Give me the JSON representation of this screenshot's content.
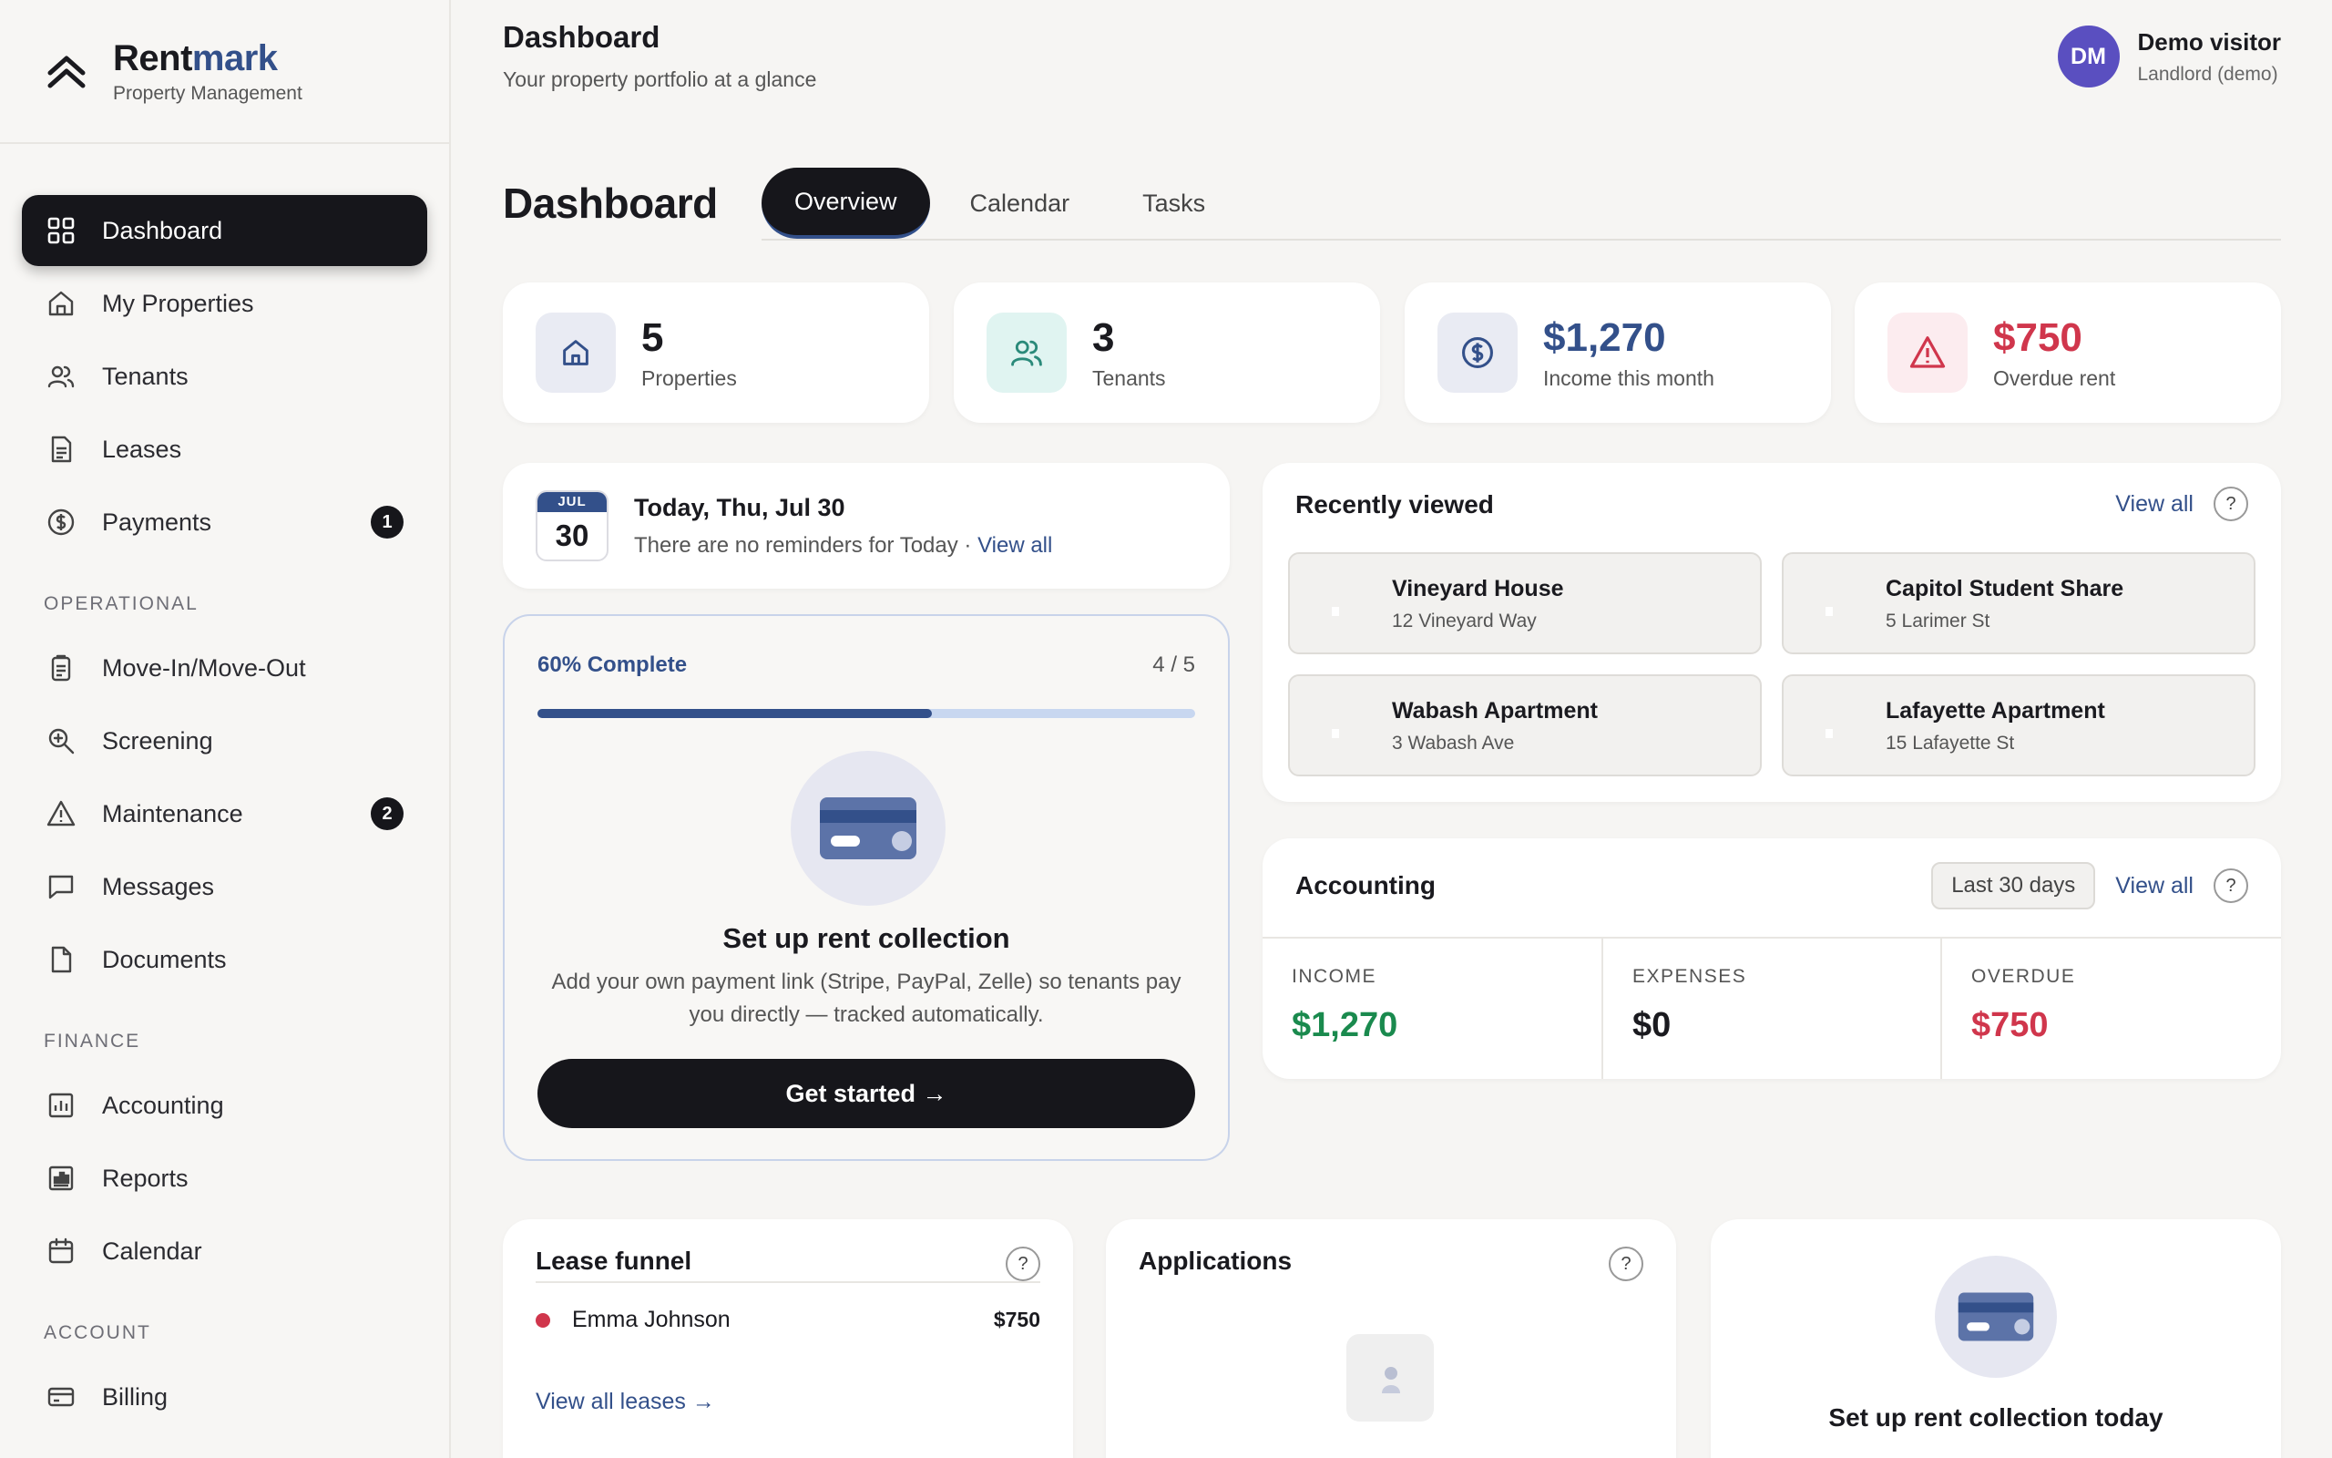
{
  "brand": {
    "name_a": "Rent",
    "name_b": "mark",
    "subtitle": "Property Management"
  },
  "nav": {
    "main": [
      {
        "label": "Dashboard",
        "icon": "grid-icon",
        "active": true
      },
      {
        "label": "My Properties",
        "icon": "home-icon"
      },
      {
        "label": "Tenants",
        "icon": "users-icon"
      },
      {
        "label": "Leases",
        "icon": "file-icon"
      },
      {
        "label": "Payments",
        "icon": "dollar-circle-icon",
        "badge": "1"
      }
    ],
    "operational_label": "OPERATIONAL",
    "operational": [
      {
        "label": "Move-In/Move-Out",
        "icon": "clipboard-icon"
      },
      {
        "label": "Screening",
        "icon": "zoom-in-icon"
      },
      {
        "label": "Maintenance",
        "icon": "warning-icon",
        "badge": "2"
      },
      {
        "label": "Messages",
        "icon": "message-icon"
      },
      {
        "label": "Documents",
        "icon": "document-icon"
      }
    ],
    "finance_label": "FINANCE",
    "finance": [
      {
        "label": "Accounting",
        "icon": "chart-icon"
      },
      {
        "label": "Reports",
        "icon": "report-icon"
      },
      {
        "label": "Calendar",
        "icon": "calendar-icon"
      }
    ],
    "account_label": "ACCOUNT",
    "account": [
      {
        "label": "Billing",
        "icon": "card-icon"
      }
    ]
  },
  "header": {
    "title": "Dashboard",
    "subtitle": "Your property portfolio at a glance"
  },
  "user": {
    "initials": "DM",
    "name": "Demo visitor",
    "role": "Landlord (demo)"
  },
  "page": {
    "title": "Dashboard",
    "tabs": [
      "Overview",
      "Calendar",
      "Tasks"
    ]
  },
  "stats": [
    {
      "value": "5",
      "label": "Properties",
      "color": "#1a1a1f"
    },
    {
      "value": "3",
      "label": "Tenants",
      "color": "#1a1a1f"
    },
    {
      "value": "$1,270",
      "label": "Income this month",
      "color": "#33508a"
    },
    {
      "value": "$750",
      "label": "Overdue rent",
      "color": "#d0364c"
    }
  ],
  "today": {
    "month": "JUL",
    "day": "30",
    "title": "Today, Thu, Jul 30",
    "text": "There are no reminders for Today · ",
    "link": "View all"
  },
  "setup": {
    "progress_label": "60% Complete",
    "progress_count": "4 / 5",
    "progress_fraction": 0.6,
    "title": "Set up rent collection",
    "description": "Add your own payment link (Stripe, PayPal, Zelle) so tenants pay you directly — tracked automatically.",
    "button": "Get started →"
  },
  "recent": {
    "title": "Recently viewed",
    "view_all": "View all",
    "help": "?",
    "items": [
      {
        "name": "Vineyard House",
        "address": "12 Vineyard Way"
      },
      {
        "name": "Capitol Student Share",
        "address": "5 Larimer St"
      },
      {
        "name": "Wabash Apartment",
        "address": "3 Wabash Ave"
      },
      {
        "name": "Lafayette Apartment",
        "address": "15 Lafayette St"
      }
    ]
  },
  "accounting": {
    "title": "Accounting",
    "range": "Last 30 days",
    "view_all": "View all",
    "help": "?",
    "cols": [
      {
        "label": "INCOME",
        "value": "$1,270",
        "color": "#1a8a4e"
      },
      {
        "label": "EXPENSES",
        "value": "$0",
        "color": "#1a1a1f"
      },
      {
        "label": "OVERDUE",
        "value": "$750",
        "color": "#d0364c"
      }
    ]
  },
  "lease_funnel": {
    "title": "Lease funnel",
    "help": "?",
    "row_name": "Emma Johnson",
    "row_amount": "$750",
    "link": "View all leases →"
  },
  "applications": {
    "title": "Applications",
    "help": "?"
  },
  "promo": {
    "title": "Set up rent collection today"
  },
  "colors": {
    "accent": "#33508a",
    "dark": "#16161b",
    "danger": "#d0364c",
    "success": "#1a8a4e"
  }
}
